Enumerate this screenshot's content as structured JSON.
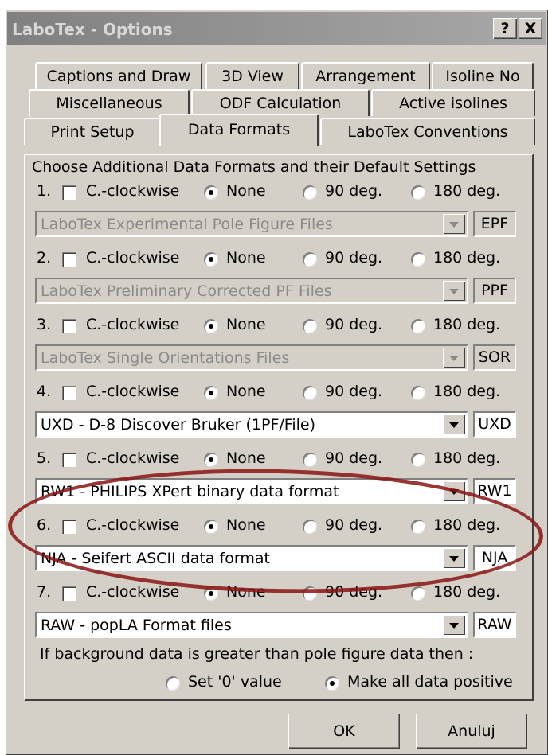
{
  "window": {
    "title": "LaboTex - Options",
    "help_label": "?",
    "close_label": "X"
  },
  "tabs": {
    "row1": [
      "Captions and Draw",
      "3D View",
      "Arrangement",
      "Isoline No"
    ],
    "row2": [
      "Miscellaneous",
      "ODF Calculation",
      "Active isolines"
    ],
    "row3": [
      "Print Setup",
      "Data Formats",
      "LaboTex Conventions"
    ],
    "active": "Data Formats"
  },
  "panel": {
    "heading": "Choose Additional Data Formats and their Default Settings",
    "labels": {
      "clockwise": "C.-clockwise",
      "none": "None",
      "deg90": "90 deg.",
      "deg180": "180 deg."
    },
    "formats": [
      {
        "num": "1.",
        "checked": false,
        "rotation": "None",
        "select": "LaboTex Experimental Pole Figure Files",
        "ext": "EPF",
        "disabled": true
      },
      {
        "num": "2.",
        "checked": false,
        "rotation": "None",
        "select": "LaboTex Preliminary Corrected PF Files",
        "ext": "PPF",
        "disabled": true
      },
      {
        "num": "3.",
        "checked": false,
        "rotation": "None",
        "select": "LaboTex Single Orientations Files",
        "ext": "SOR",
        "disabled": true
      },
      {
        "num": "4.",
        "checked": false,
        "rotation": "None",
        "select": "UXD - D-8 Discover Bruker (1PF/File)",
        "ext": "UXD",
        "disabled": false
      },
      {
        "num": "5.",
        "checked": false,
        "rotation": "None",
        "select": "RW1 - PHILIPS XPert binary data format",
        "ext": "RW1",
        "disabled": false
      },
      {
        "num": "6.",
        "checked": false,
        "rotation": "None",
        "select": "NJA - Seifert ASCII data format",
        "ext": "NJA",
        "disabled": false
      },
      {
        "num": "7.",
        "checked": false,
        "rotation": "None",
        "select": "RAW - popLA Format files",
        "ext": "RAW",
        "disabled": false
      }
    ],
    "background": {
      "question": "If background data is greater than pole figure data then :",
      "option1": "Set '0'  value",
      "option2": "Make all data positive",
      "selected": "Make all data positive"
    }
  },
  "buttons": {
    "ok": "OK",
    "cancel": "Anuluj"
  },
  "colors": {
    "window_bg": "#d4d0c8",
    "title_bar": "#808080",
    "annotation_ellipse": "#8b1414"
  }
}
